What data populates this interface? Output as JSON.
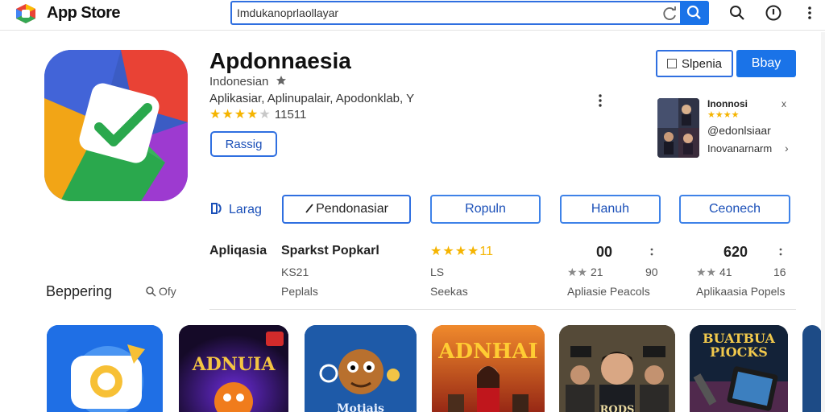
{
  "topbar": {
    "brand": "App Store",
    "search_value": "Imdukanoprlaollayar",
    "icons": [
      "refresh-icon",
      "search-icon",
      "magnifier-icon",
      "info-icon",
      "more-vertical-icon"
    ]
  },
  "app": {
    "title": "Apdonnaesia",
    "developer": "Indonesian",
    "categories": "Aplikasiar, Aplinupalair, Apodonklab,  Y",
    "rating_count": "11511",
    "rating_stars": 4,
    "install_label": "Rassig"
  },
  "actions": {
    "share_label": "Slpenia",
    "buy_label": "Bbay"
  },
  "side_card": {
    "name": "Inonnosi",
    "close": "x",
    "stars": "★★★★",
    "handle": "@edonlsiaar",
    "sub": "Inovanarnarm"
  },
  "tabs": {
    "lang_label": "Larag",
    "items": [
      "Pendonasiar",
      "Ropuln",
      "Hanuh",
      "Ceonech"
    ]
  },
  "stats": {
    "col1_title": "Apliqasia",
    "col2_title": "Sparkst Popkarl",
    "col2_val": "KS21",
    "col2_sub": "Peplals",
    "col3_stars": "★★★★",
    "col3_val_text": "11",
    "col3_val": "LS",
    "col3_sub": "Seekas",
    "col4_val": "00",
    "col4_rating": "21",
    "col4_side": "90",
    "col4_sub": "Apliasie Peacols",
    "col5_val": "620",
    "col5_rating": "41",
    "col5_side": "16",
    "col5_sub": "Aplikaasia Popels"
  },
  "section": {
    "title": "Beppering",
    "search": "Ofy"
  },
  "tiles": [
    {
      "name": "tile-camera-app",
      "text": ""
    },
    {
      "name": "tile-adnuia-game",
      "text": "ADNUIA"
    },
    {
      "name": "tile-monkey-game",
      "text": "Motiais"
    },
    {
      "name": "tile-adnhai-game",
      "text": "ADNHAI"
    },
    {
      "name": "tile-hero-game",
      "text": "RODS"
    },
    {
      "name": "tile-buatbua-game",
      "text": "BUATBUA PIOCKS"
    }
  ]
}
